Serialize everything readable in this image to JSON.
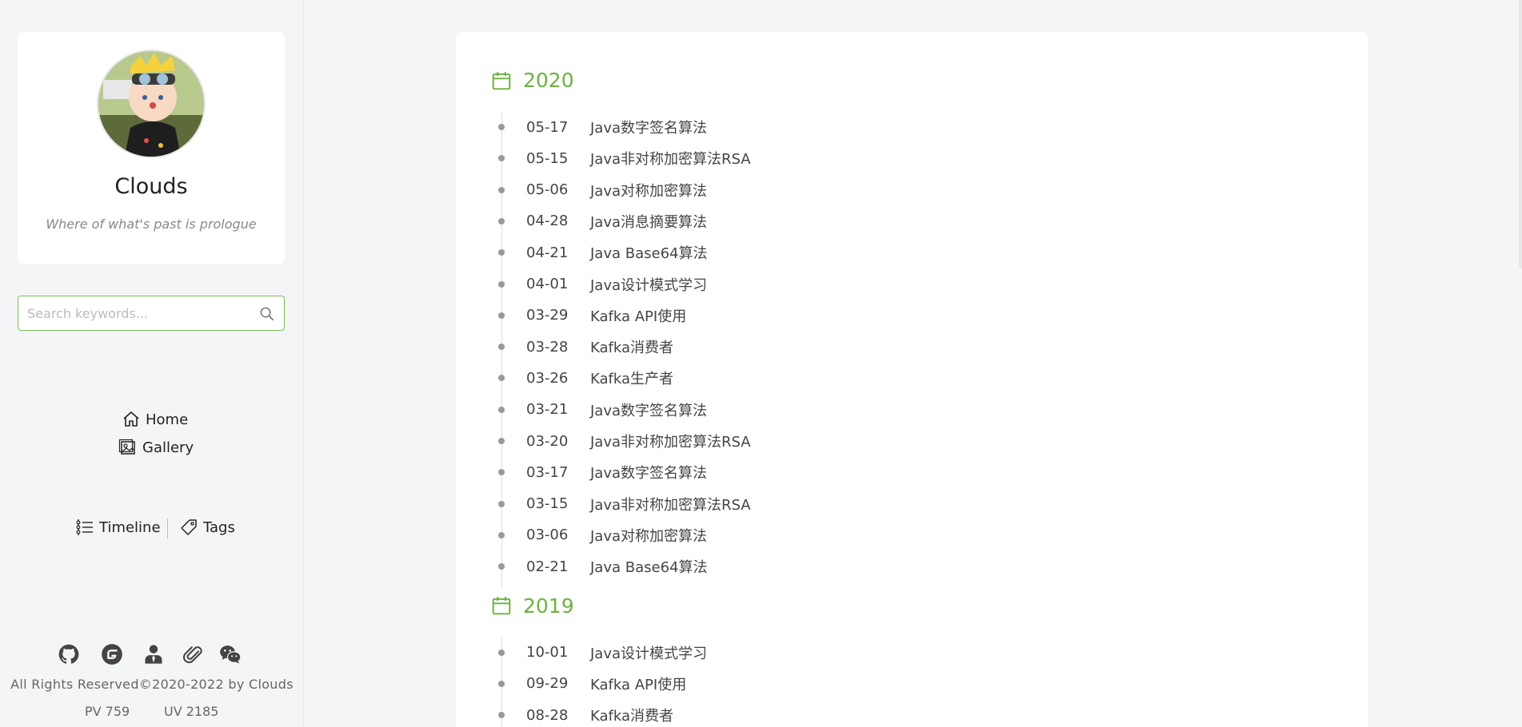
{
  "profile": {
    "name": "Clouds",
    "motto": "Where of what's past is prologue"
  },
  "search": {
    "placeholder": "Search keywords..."
  },
  "nav": {
    "home": "Home",
    "gallery": "Gallery",
    "timeline": "Timeline",
    "tags": "Tags"
  },
  "social_icons": [
    "github-icon",
    "gitee-icon",
    "user-icon",
    "attachment-icon",
    "wechat-icon"
  ],
  "footer": {
    "copyright": "All Rights Reserved©2020-2022 by Clouds",
    "pv": "PV 759",
    "uv": "UV 2185"
  },
  "colors": {
    "accent": "#6bb33b",
    "background": "#f4f5f7"
  },
  "timeline": [
    {
      "year": "2020",
      "posts": [
        {
          "date": "05-17",
          "title": "Java数字签名算法"
        },
        {
          "date": "05-15",
          "title": "Java非对称加密算法RSA"
        },
        {
          "date": "05-06",
          "title": "Java对称加密算法"
        },
        {
          "date": "04-28",
          "title": "Java消息摘要算法"
        },
        {
          "date": "04-21",
          "title": "Java Base64算法"
        },
        {
          "date": "04-01",
          "title": "Java设计模式学习"
        },
        {
          "date": "03-29",
          "title": "Kafka API使用"
        },
        {
          "date": "03-28",
          "title": "Kafka消费者"
        },
        {
          "date": "03-26",
          "title": "Kafka生产者"
        },
        {
          "date": "03-21",
          "title": "Java数字签名算法"
        },
        {
          "date": "03-20",
          "title": "Java非对称加密算法RSA"
        },
        {
          "date": "03-17",
          "title": "Java数字签名算法"
        },
        {
          "date": "03-15",
          "title": "Java非对称加密算法RSA"
        },
        {
          "date": "03-06",
          "title": "Java对称加密算法"
        },
        {
          "date": "02-21",
          "title": "Java Base64算法"
        }
      ]
    },
    {
      "year": "2019",
      "posts": [
        {
          "date": "10-01",
          "title": "Java设计模式学习"
        },
        {
          "date": "09-29",
          "title": "Kafka API使用"
        },
        {
          "date": "08-28",
          "title": "Kafka消费者"
        }
      ]
    }
  ]
}
